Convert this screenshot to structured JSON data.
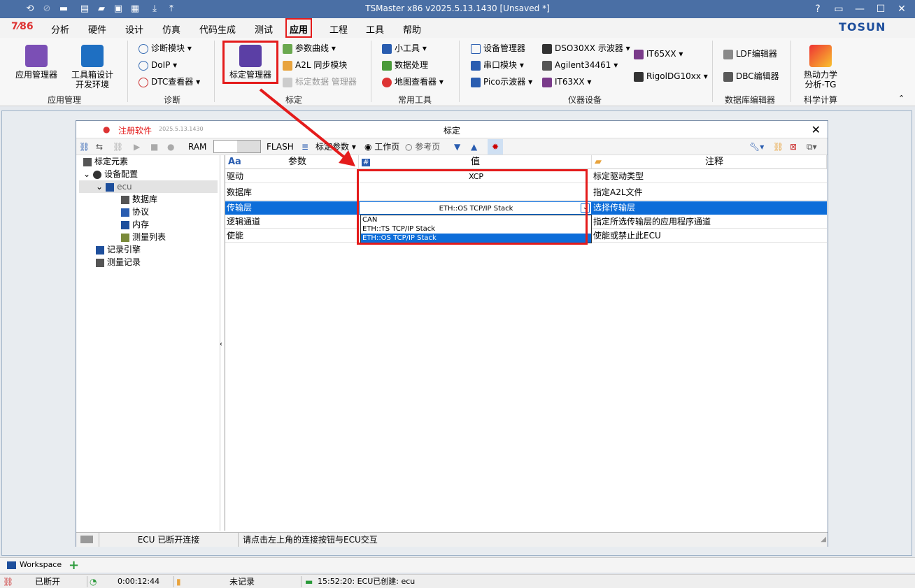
{
  "app": {
    "title": "TSMaster x86 v2025.5.13.1430 [Unsaved *]",
    "win_help": "?",
    "logo": "TOSUN"
  },
  "menu": [
    "分析",
    "硬件",
    "设计",
    "仿真",
    "代码生成",
    "测试",
    "应用",
    "工程",
    "工具",
    "帮助"
  ],
  "ribbon": {
    "app_manager": "应用管理器",
    "toolbox": [
      "工具箱设计",
      "开发环境"
    ],
    "grp_app": "应用管理",
    "diag": [
      "诊断模块",
      "DoIP",
      "DTC查看器"
    ],
    "grp_diag": "诊断",
    "calib_mgr": "标定管理器",
    "calib_items": [
      "参数曲线",
      "A2L 同步模块",
      "标定数据 管理器"
    ],
    "grp_calib": "标定",
    "tools": [
      "小工具",
      "数据处理",
      "地图查看器"
    ],
    "grp_tools": "常用工具",
    "instr": [
      "设备管理器",
      "串口模块",
      "Pico示波器",
      "DSO30XX 示波器",
      "Agilent34461",
      "IT63XX",
      "IT65XX",
      "RigolDG10xx"
    ],
    "grp_instr": "仪器设备",
    "db": [
      "LDF编辑器",
      "DBC编辑器"
    ],
    "grp_db": "数据库编辑器",
    "sci": [
      "热动力学",
      "分析-TG"
    ],
    "grp_sci": "科学计算"
  },
  "dialog": {
    "register": "注册软件",
    "version": "2025.5.13.1430",
    "title": "标定",
    "close": "✕",
    "toolbar": {
      "ram": "RAM",
      "flash": "FLASH",
      "calib_params": "标定参数",
      "work_page": "工作页",
      "ref_page": "参考页"
    },
    "tree": {
      "root": "标定元素",
      "dev_cfg": "设备配置",
      "ecu": "ecu",
      "children": [
        "数据库",
        "协议",
        "内存",
        "测量列表"
      ],
      "rec_engine": "记录引擎",
      "meas_rec": "测量记录"
    },
    "grid": {
      "headers": {
        "param": "参数",
        "value": "值",
        "comment": "注释"
      },
      "header_icons": {
        "param": "Aa",
        "value": "#"
      },
      "rows": [
        {
          "param": "驱动",
          "value": "XCP",
          "comment": "标定驱动类型"
        },
        {
          "param": "数据库",
          "value": "",
          "comment": "指定A2L文件"
        },
        {
          "param": "传输层",
          "value": "ETH::OS TCP/IP Stack",
          "comment": "选择传输层"
        },
        {
          "param": "逻辑通道",
          "value": "",
          "comment": "指定所选传输层的应用程序通道"
        },
        {
          "param": "使能",
          "value": "",
          "comment": "使能或禁止此ECU"
        }
      ],
      "dropdown": [
        "CAN",
        "ETH::TS TCP/IP Stack",
        "ETH::OS TCP/IP Stack"
      ]
    },
    "status": {
      "left": "ECU 已断开连接",
      "right": "请点击左上角的连接按钮与ECU交互"
    }
  },
  "workspace": {
    "tab": "Workspace"
  },
  "statusbar": {
    "conn": "已断开",
    "time": "0:00:12:44",
    "rec": "未记录",
    "msg": "15:52:20: ECU已创建: ecu"
  },
  "colors": {
    "titlebar": "#4a6fa5",
    "selection": "#0d6dd9",
    "highlight": "#e41b1b"
  }
}
